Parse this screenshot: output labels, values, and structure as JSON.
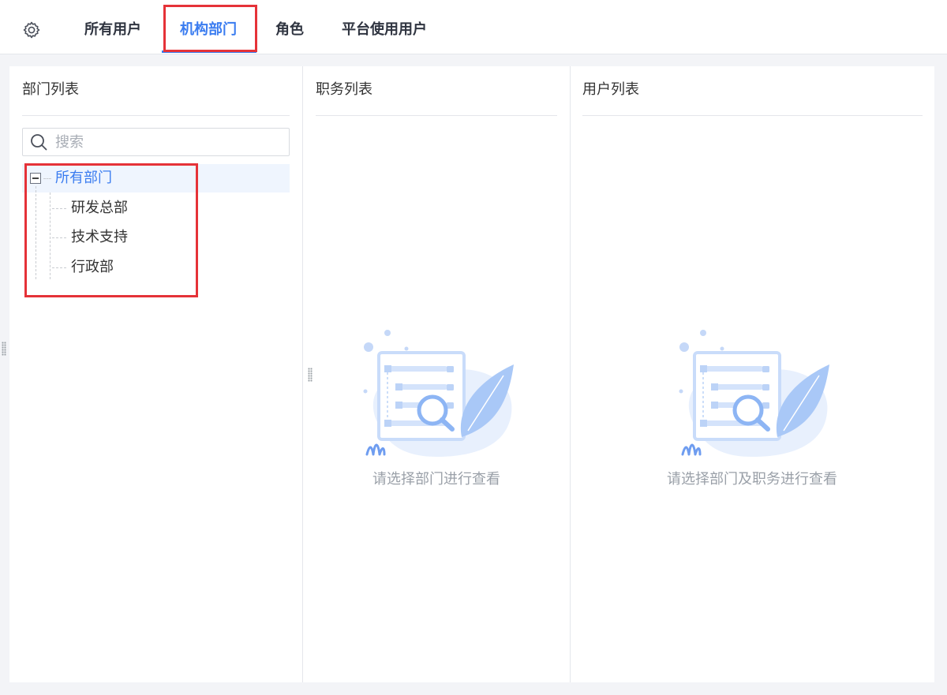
{
  "tabs": [
    {
      "label": "所有用户",
      "active": false
    },
    {
      "label": "机构部门",
      "active": true
    },
    {
      "label": "角色",
      "active": false
    },
    {
      "label": "平台使用用户",
      "active": false
    }
  ],
  "icons": {
    "settings": "gear-icon",
    "search": "search-icon",
    "tree_toggle": "minus-square-icon",
    "empty_state": "empty-search-illustration"
  },
  "colors": {
    "accent": "#3a7cf0",
    "highlight_box": "#e53238",
    "selected_row_bg": "#eff5fe",
    "muted_text": "#9aa0a8"
  },
  "department_panel": {
    "title": "部门列表",
    "search_placeholder": "搜索",
    "tree": {
      "root": {
        "label": "所有部门",
        "expanded": true,
        "selected": true
      },
      "children": [
        {
          "label": "研发总部"
        },
        {
          "label": "技术支持"
        },
        {
          "label": "行政部"
        }
      ]
    }
  },
  "position_panel": {
    "title": "职务列表",
    "empty_text": "请选择部门进行查看"
  },
  "user_panel": {
    "title": "用户列表",
    "empty_text": "请选择部门及职务进行查看"
  }
}
